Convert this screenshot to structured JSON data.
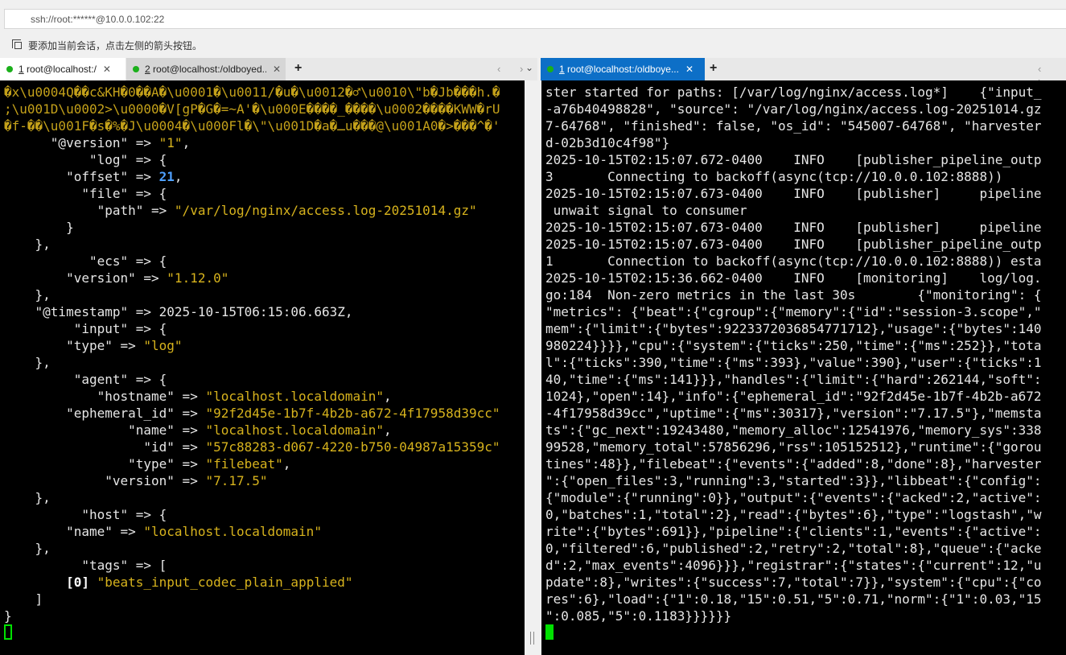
{
  "address": {
    "value": "ssh://root:******@10.0.0.102:22"
  },
  "hint": {
    "text": "要添加当前会话，点击左侧的箭头按钮。",
    "icon": "session-add-icon"
  },
  "left_tabs": [
    {
      "number": "1",
      "label": " root@localhost:/",
      "close": "✕",
      "status_color": "#1bb01b"
    },
    {
      "number": "2",
      "label": " root@localhost:/oldboyed...",
      "close": "✕",
      "status_color": "#1bb01b"
    }
  ],
  "right_tabs": [
    {
      "number": "1",
      "label": " root@localhost:/oldboye...",
      "close": "✕",
      "status_color": "#1bb01b"
    }
  ],
  "tabbar": {
    "add": "+",
    "nav": "‹ ›",
    "dropdown": "⌄"
  },
  "left_terminal": {
    "garbled": [
      "�x\\u0004Q��c&KH�0��A�\\u0001�\\u0011/�u�\\u0012�♂\\u0010\\\"b�Jb���h.�",
      ";\\u001D\\u0002>\\u0000�V[gP�G�=~A'�\\u000E����_����\\u0002����KWW�rU",
      "�f-��\\u001F�s�%�J\\u0004�\\u000Fl�\\\"\\u001D�a�ـu���@\\u001A0�>���^�'"
    ],
    "lines": [
      [
        [
          "w",
          "      \"@version\" => "
        ],
        [
          "y",
          "\"1\""
        ],
        [
          "w",
          ","
        ]
      ],
      [
        [
          "w",
          "           \"log\" => {"
        ]
      ],
      [
        [
          "w",
          "        \"offset\" => "
        ],
        [
          "n",
          "21"
        ],
        [
          "w",
          ","
        ]
      ],
      [
        [
          "w",
          "          \"file\" => {"
        ]
      ],
      [
        [
          "w",
          "            \"path\" => "
        ],
        [
          "y",
          "\"/var/log/nginx/access.log-20251014.gz\""
        ]
      ],
      [
        [
          "w",
          "        }"
        ]
      ],
      [
        [
          "w",
          "    },"
        ]
      ],
      [
        [
          "w",
          "           \"ecs\" => {"
        ]
      ],
      [
        [
          "w",
          "        \"version\" => "
        ],
        [
          "y",
          "\"1.12.0\""
        ]
      ],
      [
        [
          "w",
          "    },"
        ]
      ],
      [
        [
          "w",
          "    \"@timestamp\" => 2025-10-15T06:15:06.663Z,"
        ]
      ],
      [
        [
          "w",
          "         \"input\" => {"
        ]
      ],
      [
        [
          "w",
          "        \"type\" => "
        ],
        [
          "y",
          "\"log\""
        ]
      ],
      [
        [
          "w",
          "    },"
        ]
      ],
      [
        [
          "w",
          "         \"agent\" => {"
        ]
      ],
      [
        [
          "w",
          "            \"hostname\" => "
        ],
        [
          "y",
          "\"localhost.localdomain\""
        ],
        [
          "w",
          ","
        ]
      ],
      [
        [
          "w",
          "        \"ephemeral_id\" => "
        ],
        [
          "y",
          "\"92f2d45e-1b7f-4b2b-a672-4f17958d39cc\""
        ]
      ],
      [
        [
          "w",
          "                \"name\" => "
        ],
        [
          "y",
          "\"localhost.localdomain\""
        ],
        [
          "w",
          ","
        ]
      ],
      [
        [
          "w",
          "                  \"id\" => "
        ],
        [
          "y",
          "\"57c88283-d067-4220-b750-04987a15359c\""
        ]
      ],
      [
        [
          "w",
          "                \"type\" => "
        ],
        [
          "y",
          "\"filebeat\""
        ],
        [
          "w",
          ","
        ]
      ],
      [
        [
          "w",
          "             \"version\" => "
        ],
        [
          "y",
          "\"7.17.5\""
        ]
      ],
      [
        [
          "w",
          "    },"
        ]
      ],
      [
        [
          "w",
          "          \"host\" => {"
        ]
      ],
      [
        [
          "w",
          "        \"name\" => "
        ],
        [
          "y",
          "\"localhost.localdomain\""
        ]
      ],
      [
        [
          "w",
          "    },"
        ]
      ],
      [
        [
          "w",
          "          \"tags\" => ["
        ]
      ],
      [
        [
          "w",
          "        "
        ],
        [
          "idx",
          "[0]"
        ],
        [
          "w",
          " "
        ],
        [
          "y",
          "\"beats_input_codec_plain_applied\""
        ]
      ],
      [
        [
          "w",
          "    ]"
        ]
      ],
      [
        [
          "w",
          "}"
        ]
      ]
    ]
  },
  "right_terminal": {
    "lines": [
      "ster started for paths: [/var/log/nginx/access.log*]    {\"input_",
      "-a76b40498828\", \"source\": \"/var/log/nginx/access.log-20251014.gz",
      "7-64768\", \"finished\": false, \"os_id\": \"545007-64768\", \"harvester",
      "d-02b3d10c4f98\"}",
      "2025-10-15T02:15:07.672-0400    INFO    [publisher_pipeline_outp",
      "3       Connecting to backoff(async(tcp://10.0.0.102:8888))",
      "2025-10-15T02:15:07.673-0400    INFO    [publisher]     pipeline",
      " unwait signal to consumer",
      "2025-10-15T02:15:07.673-0400    INFO    [publisher]     pipeline",
      "2025-10-15T02:15:07.673-0400    INFO    [publisher_pipeline_outp",
      "1       Connection to backoff(async(tcp://10.0.0.102:8888)) esta",
      "2025-10-15T02:15:36.662-0400    INFO    [monitoring]    log/log.",
      "go:184  Non-zero metrics in the last 30s        {\"monitoring\": {",
      "\"metrics\": {\"beat\":{\"cgroup\":{\"memory\":{\"id\":\"session-3.scope\",\"",
      "mem\":{\"limit\":{\"bytes\":9223372036854771712},\"usage\":{\"bytes\":140",
      "980224}}}},\"cpu\":{\"system\":{\"ticks\":250,\"time\":{\"ms\":252}},\"tota",
      "l\":{\"ticks\":390,\"time\":{\"ms\":393},\"value\":390},\"user\":{\"ticks\":1",
      "40,\"time\":{\"ms\":141}}},\"handles\":{\"limit\":{\"hard\":262144,\"soft\":",
      "1024},\"open\":14},\"info\":{\"ephemeral_id\":\"92f2d45e-1b7f-4b2b-a672",
      "-4f17958d39cc\",\"uptime\":{\"ms\":30317},\"version\":\"7.17.5\"},\"memsta",
      "ts\":{\"gc_next\":19243480,\"memory_alloc\":12541976,\"memory_sys\":338",
      "99528,\"memory_total\":57856296,\"rss\":105152512},\"runtime\":{\"gorou",
      "tines\":48}},\"filebeat\":{\"events\":{\"added\":8,\"done\":8},\"harvester",
      "\":{\"open_files\":3,\"running\":3,\"started\":3}},\"libbeat\":{\"config\":",
      "{\"module\":{\"running\":0}},\"output\":{\"events\":{\"acked\":2,\"active\":",
      "0,\"batches\":1,\"total\":2},\"read\":{\"bytes\":6},\"type\":\"logstash\",\"w",
      "rite\":{\"bytes\":691}},\"pipeline\":{\"clients\":1,\"events\":{\"active\":",
      "0,\"filtered\":6,\"published\":2,\"retry\":2,\"total\":8},\"queue\":{\"acke",
      "d\":2,\"max_events\":4096}}},\"registrar\":{\"states\":{\"current\":12,\"u",
      "pdate\":8},\"writes\":{\"success\":7,\"total\":7}},\"system\":{\"cpu\":{\"co",
      "res\":6},\"load\":{\"1\":0.18,\"15\":0.51,\"5\":0.71,\"norm\":{\"1\":0.03,\"15",
      "\":0.085,\"5\":0.1183}}}}}}"
    ]
  },
  "colors": {
    "terminal_bg": "#000000",
    "string": "#d7b31d",
    "number": "#4fa0ff",
    "cursor": "#00e000",
    "active_tab": "#0d6fc7"
  }
}
